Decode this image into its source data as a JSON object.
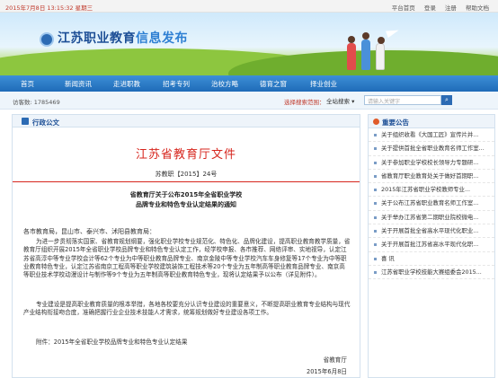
{
  "topbar": {
    "date": "2015年7月8日 13:15:32 星期三",
    "links": [
      "平台首页",
      "登录",
      "注册",
      "帮助文档"
    ]
  },
  "banner": {
    "title_main": "江苏职业教育",
    "title_highlight": "信息发布"
  },
  "nav": {
    "items": [
      "首页",
      "新闻资讯",
      "走进职教",
      "招考专列",
      "治校方略",
      "德育之窗",
      "择业创业"
    ]
  },
  "infobar": {
    "visits": "访客数: 1785469",
    "site_label": "选择搜索范围：",
    "site_select": "全站搜索 ▾",
    "search_placeholder": "请输入关键字",
    "search_icon": "search-icon"
  },
  "main": {
    "section_title": "行政公文",
    "doc_title": "江苏省教育厅文件",
    "doc_number": "苏教职【2015】24号",
    "notice_title_line1": "省教育厅关于公布2015年全省职业学校",
    "notice_title_line2": "品牌专业和特色专业认定结果的通知",
    "addressee": "各市教育局，昆山市、泰兴市、沭阳县教育局：",
    "para1": "为进一步贯彻落实国家、省教育规划纲要，强化职业学校专业规范化、特色化、品牌化建设，提高职业教育教学质量，省教育厅组织开展2015年全省职业学校品牌专业和特色专业认定工作，经学校申报、各市推荐、网络评审、实地视导，认定江苏省高淳中等专业学校会计等62个专业为中等职业教育品牌专业、南京金陵中等专业学校汽车车身修复等17个专业为中等职业教育特色专业，认定江苏省南京工程高等职业学校建筑装饰工程技术等20个专业为五年制高等职业教育品牌专业、南京高等职业技术学校动漫设计与制作等9个专业为五年制高等职业教育特色专业，现将认定结果予以公布（详见附件）。",
    "para2": "专业建设是提高职业教育质量的根本举措，各地各校要充分认识专业建设的重要意义，不断提高职业教育专业结构与现代产业结构衔接吻合度，准确把握行业企业技术技能人才需求，统筹规划做好专业建设各项工作。",
    "attachment": "附件：2015年全省职业学校品牌专业和特色专业认定结果",
    "signer": "省教育厅",
    "sign_date": "2015年6月8日"
  },
  "sidebar": {
    "title": "重要公告",
    "items": [
      "关于组织收看《大国工匠》宣传片并...",
      "关于提供首批全省职业教育名师工作室...",
      "关于参加职业学校校长领导力专题研...",
      "省教育厅职业教育处关于做好首期职...",
      "2015年江苏省职业学校教师专业...",
      "关于公布江苏省职业教育名师工作室...",
      "关于举办江苏省第二期职业院校微电...",
      "关于开展首批全省高水平现代化职业...",
      "关于开展首批江苏省高水平现代化职...",
      "喜 讯",
      "江苏省职业学校技能大赛组委会2015..."
    ]
  },
  "colors": {
    "brand_blue": "#1f6bb8",
    "doc_red": "#d7261e"
  }
}
